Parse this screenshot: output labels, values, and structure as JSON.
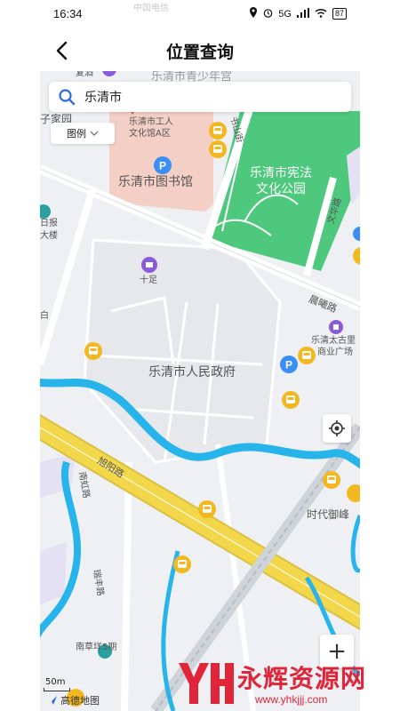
{
  "status_bar": {
    "time": "16:34",
    "carrier": "中国电信",
    "network": "5G",
    "battery": "87"
  },
  "header": {
    "title": "位置查询",
    "back_icon": "chevron-left-icon"
  },
  "search": {
    "value": "乐清市",
    "icon": "search-icon"
  },
  "legend": {
    "label": "图例",
    "icon": "chevron-down-icon"
  },
  "map": {
    "labels": {
      "government": "乐清市人民政府",
      "library": "乐清市图书馆",
      "park_line1": "乐清市宪法",
      "park_line2": "文化公园",
      "workers_line1": "乐清市工人",
      "workers_line2": "文化馆A区",
      "youth_palace": "乐清市青少年宫",
      "shizu": "十足",
      "taigu_line1": "乐清太古里",
      "taigu_line2": "商业广场",
      "chenxi_road": "晨曦路",
      "xuyang_road": "旭阳路",
      "shushan_street": "书山街",
      "wenhua_road": "文华路",
      "nanhu_road": "南虹路",
      "ruifeng_road": "瑞丰路",
      "nancaoyang": "南草垟5期",
      "shidai": "时代御峰",
      "ribao_line1": "日报",
      "ribao_line2": "大楼",
      "zijiayuan": "子家园",
      "baihe": "复酒",
      "bai": "白"
    },
    "scale": "50m",
    "provider": "高德地图",
    "park_color": "#4dc87d",
    "road_major_color": "#f3d74a",
    "river_color": "#27b4ea",
    "building_color": "#f4cfc5"
  },
  "controls": {
    "locate_icon": "locate-icon",
    "zoom_in": "+"
  },
  "watermark": {
    "text": "永辉资源网",
    "url": "www.yhkjjj.com"
  }
}
